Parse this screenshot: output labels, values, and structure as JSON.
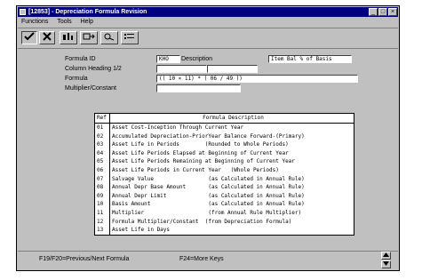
{
  "window": {
    "title": "[12853] - Depreciation Formula Revision",
    "controls": [
      "_",
      "□",
      "×"
    ]
  },
  "menu": [
    "Functions",
    "Tools",
    "Help"
  ],
  "toolbar": {
    "icons": [
      "check-icon",
      "cancel-icon",
      "info-icon",
      "form-exit-icon",
      "inquire-icon",
      "list-icon"
    ]
  },
  "form": {
    "formula_id_label": "Formula ID",
    "formula_id_value": "KHO",
    "description_label": "Description",
    "description_value": "Item Bal % of Basis",
    "column_heading_label": "Column Heading 1/2",
    "column_heading_1": "",
    "column_heading_2": "",
    "formula_label": "Formula",
    "formula_value": "(( 10 × 11) * ( 06 / 49 ))",
    "multiplier_label": "Multiplier/Constant",
    "multiplier_value": ""
  },
  "table": {
    "headers": [
      "Ref",
      "Formula Description"
    ],
    "rows": [
      {
        "ref": "01",
        "desc": "Asset Cost-Inception Through Current Year"
      },
      {
        "ref": "02",
        "desc": "Accumulated Depreciation-PriorYear Balance Forward-(Primary)"
      },
      {
        "ref": "03",
        "desc": "Asset Life in Periods        (Rounded to Whole Periods)"
      },
      {
        "ref": "04",
        "desc": "Asset Life Periods Elapsed at Beginning of Current Year"
      },
      {
        "ref": "05",
        "desc": "Asset Life Periods Remaining at Beginning of Current Year"
      },
      {
        "ref": "06",
        "desc": "Asset Life Periods in Current Year   (Whole Periods)"
      },
      {
        "ref": "07",
        "desc": "Salvage Value                 (as Calculated in Annual Rule)"
      },
      {
        "ref": "08",
        "desc": "Annual Depr Base Amount       (as Calculated in Annual Rule)"
      },
      {
        "ref": "09",
        "desc": "Annual Depr Limit             (as Calculated in Annual Rule)"
      },
      {
        "ref": "10",
        "desc": "Basis Amount                  (as Calculated in Annual Rule)"
      },
      {
        "ref": "11",
        "desc": "Multiplier                    (from Annual Rule Multiplier)"
      },
      {
        "ref": "12",
        "desc": "Formula Multiplier/Constant  (from Depreciation Formula)"
      },
      {
        "ref": "13",
        "desc": "Asset Life in Days"
      }
    ]
  },
  "status": {
    "left": "F19/F20=Previous/Next Formula",
    "right": "F24=More Keys"
  },
  "colors": {
    "titlebar": "#000080",
    "face": "#c0c0c0"
  }
}
